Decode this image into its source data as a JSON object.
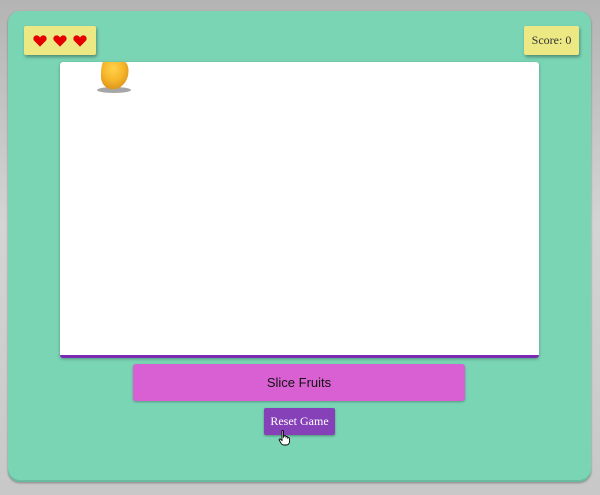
{
  "lives": {
    "count": 3,
    "icon": "heart-icon",
    "color": "#e60000"
  },
  "score": {
    "text": "Score: 0"
  },
  "play_area": {
    "fruit": "mango-icon"
  },
  "controls": {
    "slice_label": "Slice Fruits",
    "reset_label": "Reset Game"
  },
  "colors": {
    "background": "#7ad5b5",
    "panel": "#ece884",
    "slice_button": "#d960d3",
    "reset_button": "#8640b8",
    "play_area_border": "#7a2ab3"
  }
}
